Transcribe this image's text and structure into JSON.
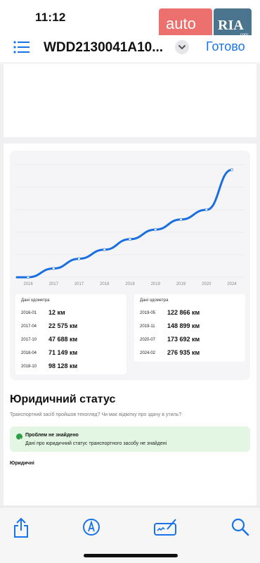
{
  "status_bar": {
    "time": "11:12"
  },
  "watermark": {
    "brand_left": "auto",
    "brand_right": "RIA",
    "domain": ".com"
  },
  "nav": {
    "title": "WDD2130041A10...",
    "done_label": "Готово"
  },
  "odometer": {
    "header": "Дані одометра",
    "left": [
      {
        "date": "2016-01",
        "value": "12 км"
      },
      {
        "date": "2017-04",
        "value": "22 575 км"
      },
      {
        "date": "2017-10",
        "value": "47 688 км"
      },
      {
        "date": "2018-04",
        "value": "71 149 км"
      },
      {
        "date": "2018-10",
        "value": "98 128 км"
      }
    ],
    "right": [
      {
        "date": "2019-05",
        "value": "122 866 км"
      },
      {
        "date": "2019-11",
        "value": "148 899 км"
      },
      {
        "date": "2020-07",
        "value": "173 692 км"
      },
      {
        "date": "2024-02",
        "value": "276 935 км"
      }
    ]
  },
  "chart_data": {
    "type": "line",
    "x": [
      "2016-01",
      "2017-04",
      "2017-10",
      "2018-04",
      "2018-10",
      "2019-05",
      "2019-11",
      "2020-07",
      "2024-02"
    ],
    "tick_labels": [
      "2016",
      "2017",
      "2017",
      "2018",
      "2018",
      "2019",
      "2019",
      "2020",
      "2024"
    ],
    "values": [
      12,
      22575,
      47688,
      71149,
      98128,
      122866,
      148899,
      173692,
      276935
    ],
    "ylim": [
      0,
      290000
    ],
    "grid": true,
    "line_color": "#1a6fe0"
  },
  "legal": {
    "title": "Юридичний статус",
    "subtitle": "Транспортний засіб пройшов техогляд? Чи має відмітку про здачу в утиль?",
    "alert_title": "Проблем не знайдено",
    "alert_text": "Дані про юридичний статус транспортного засобу не знайдені",
    "label": "Юридичні"
  }
}
